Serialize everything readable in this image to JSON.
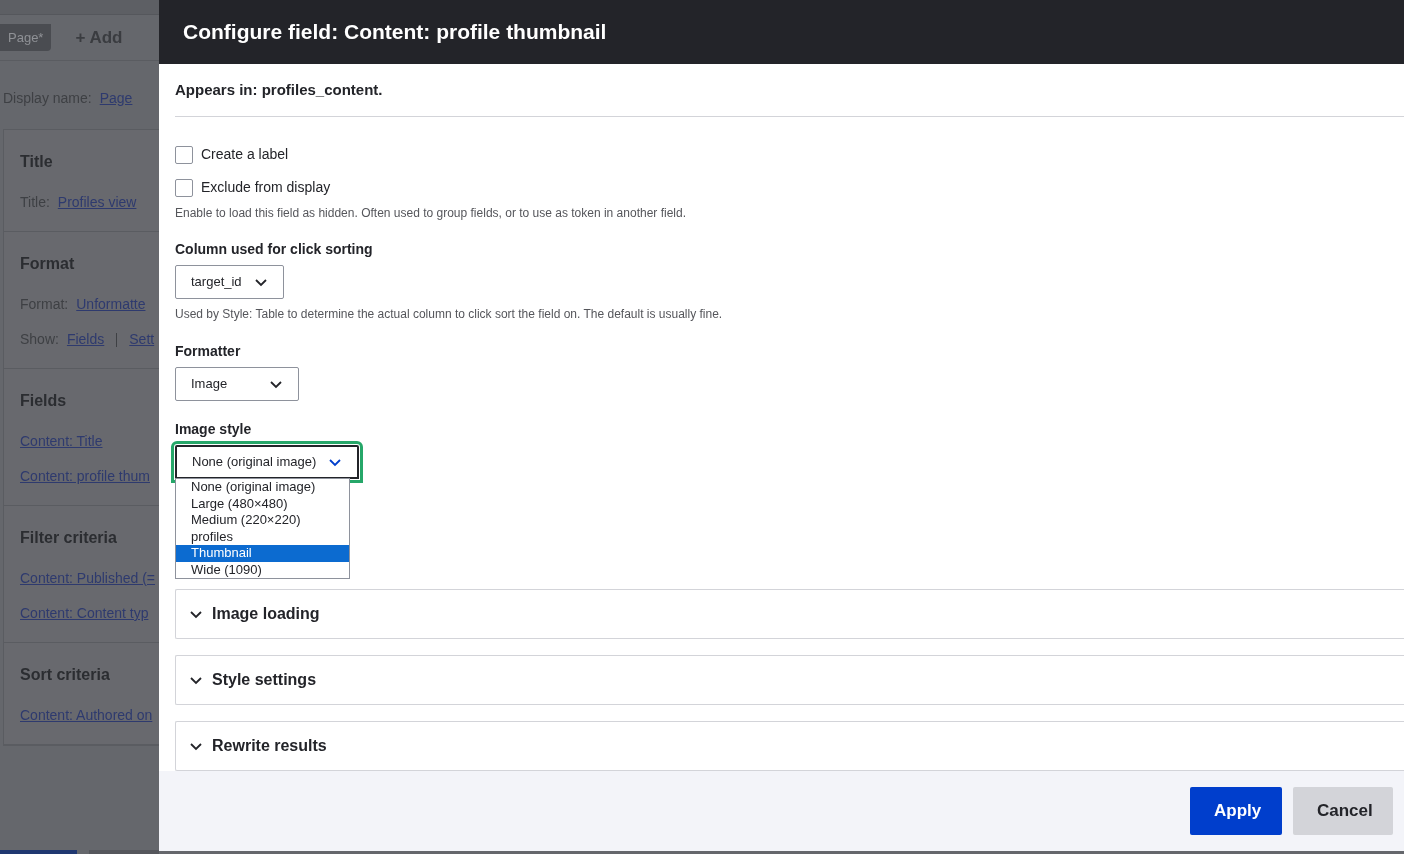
{
  "background": {
    "tabs": [
      {
        "label": "Page*",
        "selected": true
      },
      {
        "label": "+ Add",
        "selected": false
      }
    ],
    "display_name": {
      "label": "Display name:",
      "link": "Page"
    },
    "sections": [
      {
        "title": "Title",
        "rows": [
          {
            "label": "Title:",
            "links": [
              "Profiles view"
            ]
          }
        ]
      },
      {
        "title": "Format",
        "rows": [
          {
            "label": "Format:",
            "links": [
              "Unformatte"
            ]
          },
          {
            "label": "Show:",
            "links": [
              "Fields",
              "Sett"
            ]
          }
        ]
      },
      {
        "title": "Fields",
        "rows": [
          {
            "links": [
              "Content: Title"
            ]
          },
          {
            "links": [
              "Content: profile thum"
            ]
          }
        ]
      },
      {
        "title": "Filter criteria",
        "rows": [
          {
            "links": [
              "Content: Published (="
            ]
          },
          {
            "links": [
              "Content: Content typ"
            ]
          }
        ]
      },
      {
        "title": "Sort criteria",
        "rows": [
          {
            "links": [
              "Content: Authored on"
            ]
          }
        ]
      }
    ]
  },
  "dialog": {
    "title": "Configure field: Content: profile thumbnail",
    "appears_in": "Appears in: profiles_content.",
    "checkboxes": [
      {
        "label": "Create a label",
        "checked": false
      },
      {
        "label": "Exclude from display",
        "checked": false,
        "description": "Enable to load this field as hidden. Often used to group fields, or to use as token in another field."
      }
    ],
    "selects": [
      {
        "label": "Column used for click sorting",
        "value": "target_id",
        "description": "Used by Style: Table to determine the actual column to click sort the field on. The default is usually fine.",
        "focused": false,
        "open": false
      },
      {
        "label": "Formatter",
        "value": "Image",
        "focused": false,
        "open": false
      },
      {
        "label": "Image style",
        "value": "None (original image)",
        "focused": true,
        "open": true,
        "options": [
          {
            "label": "None (original image)",
            "highlighted": false
          },
          {
            "label": "Large (480×480)",
            "highlighted": false
          },
          {
            "label": "Medium (220×220)",
            "highlighted": false
          },
          {
            "label": "profiles",
            "highlighted": false
          },
          {
            "label": "Thumbnail",
            "highlighted": true
          },
          {
            "label": "Wide (1090)",
            "highlighted": false
          }
        ]
      }
    ],
    "details": [
      {
        "title": "Image loading",
        "expanded": false
      },
      {
        "title": "Style settings",
        "expanded": false
      },
      {
        "title": "Rewrite results",
        "expanded": false
      }
    ],
    "buttons": [
      {
        "label": "Apply",
        "kind": "primary"
      },
      {
        "label": "Cancel",
        "kind": "secondary"
      }
    ]
  }
}
